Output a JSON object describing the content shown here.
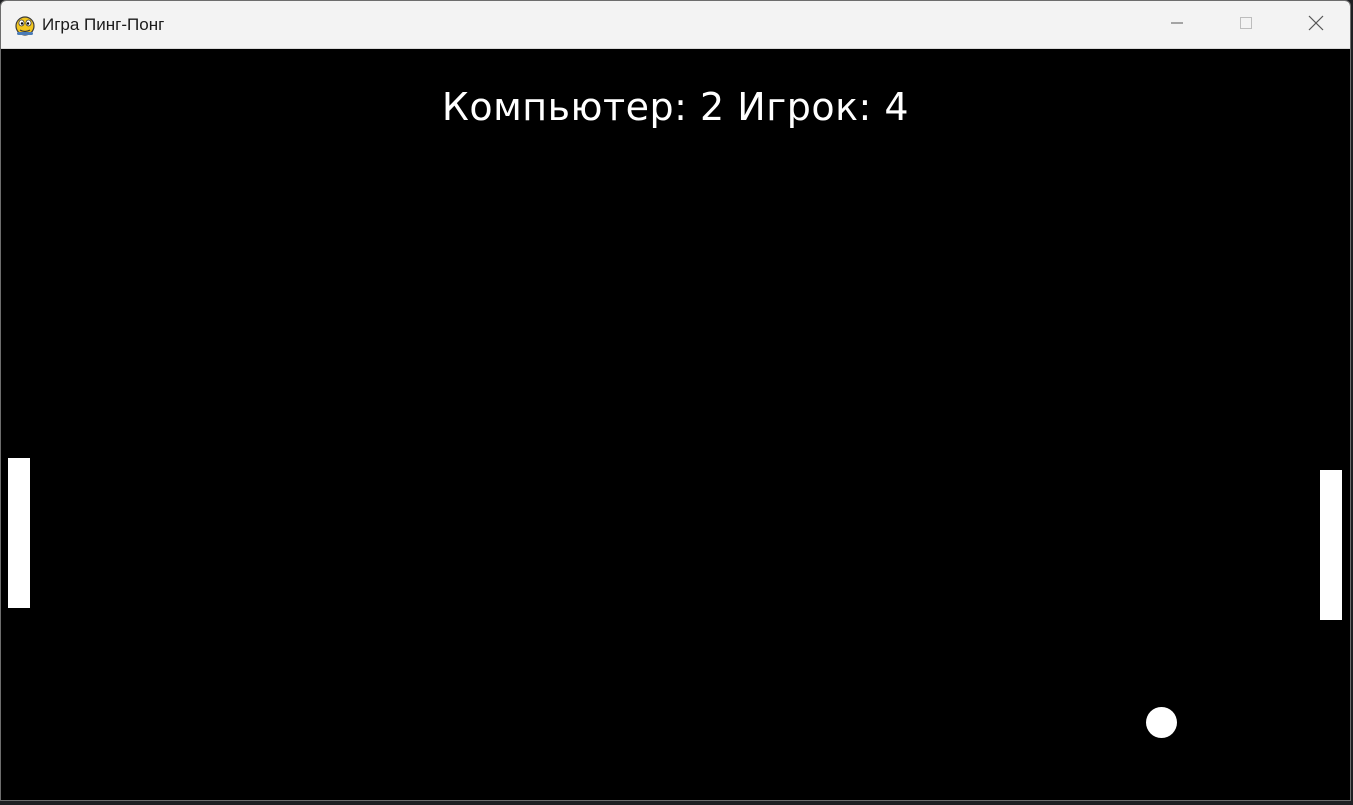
{
  "window": {
    "title": "Игра Пинг-Понг",
    "app_icon": "pygame-snake-icon",
    "controls": {
      "minimize_icon": "minimize-icon",
      "maximize_icon": "maximize-icon",
      "close_icon": "close-icon"
    }
  },
  "game": {
    "score_text": "Компьютер: 2  Игрок: 4",
    "computer_label": "Компьютер",
    "computer_score": 2,
    "player_label": "Игрок",
    "player_score": 4,
    "colors": {
      "background": "#000000",
      "foreground": "#ffffff"
    }
  }
}
